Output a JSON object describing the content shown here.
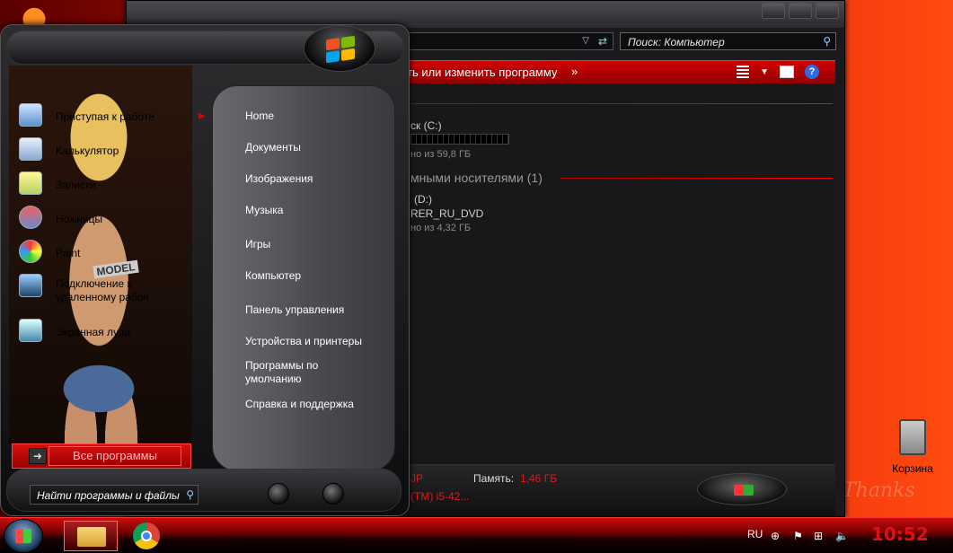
{
  "explorer": {
    "search_placeholder": "Поиск: Компьютер",
    "toolbar": {
      "action_label": "ть или изменить программу",
      "more_label": "»",
      "help_label": "?"
    },
    "drive_c": {
      "label": "ск (C:)",
      "free": "но из 59,8 ГБ"
    },
    "removable_section": "мными носителями (1)",
    "drive_d": {
      "label": "(D:)",
      "volume": "RER_RU_DVD",
      "free": "но из 4,32 ГБ"
    },
    "status": {
      "name_fragment": "JP",
      "memory_label": "Память:",
      "memory_value": "1,46 ГБ",
      "cpu_fragment": "(TM) i5-42..."
    }
  },
  "start_menu": {
    "programs": [
      {
        "label": "Приступая к работе",
        "icon": "getting-started-icon"
      },
      {
        "label": "Калькулятор",
        "icon": "calculator-icon"
      },
      {
        "label": "Записки",
        "icon": "sticky-notes-icon"
      },
      {
        "label": "Ножницы",
        "icon": "scissors-icon"
      },
      {
        "label": "Paint",
        "icon": "paint-icon"
      },
      {
        "label": "Подключение к удаленному рабоч",
        "icon": "remote-desktop-icon"
      },
      {
        "label": "Экранная лупа",
        "icon": "magnifier-icon"
      }
    ],
    "picture_text": "MODEL",
    "all_programs": "Все программы",
    "right_items": [
      "Home",
      "Документы",
      "Изображения",
      "Музыка",
      "Игры",
      "Компьютер",
      "Панель управления",
      "Устройства и принтеры",
      "Программы по умолчанию",
      "Справка и поддержка"
    ],
    "search_placeholder": "Найти программы и файлы"
  },
  "desktop": {
    "recycle_bin": "Корзина",
    "deco_text": "Thanks"
  },
  "taskbar": {
    "language": "RU",
    "clock": "10:52"
  },
  "colors": {
    "accent": "#d00000",
    "clock": "#e01010"
  }
}
